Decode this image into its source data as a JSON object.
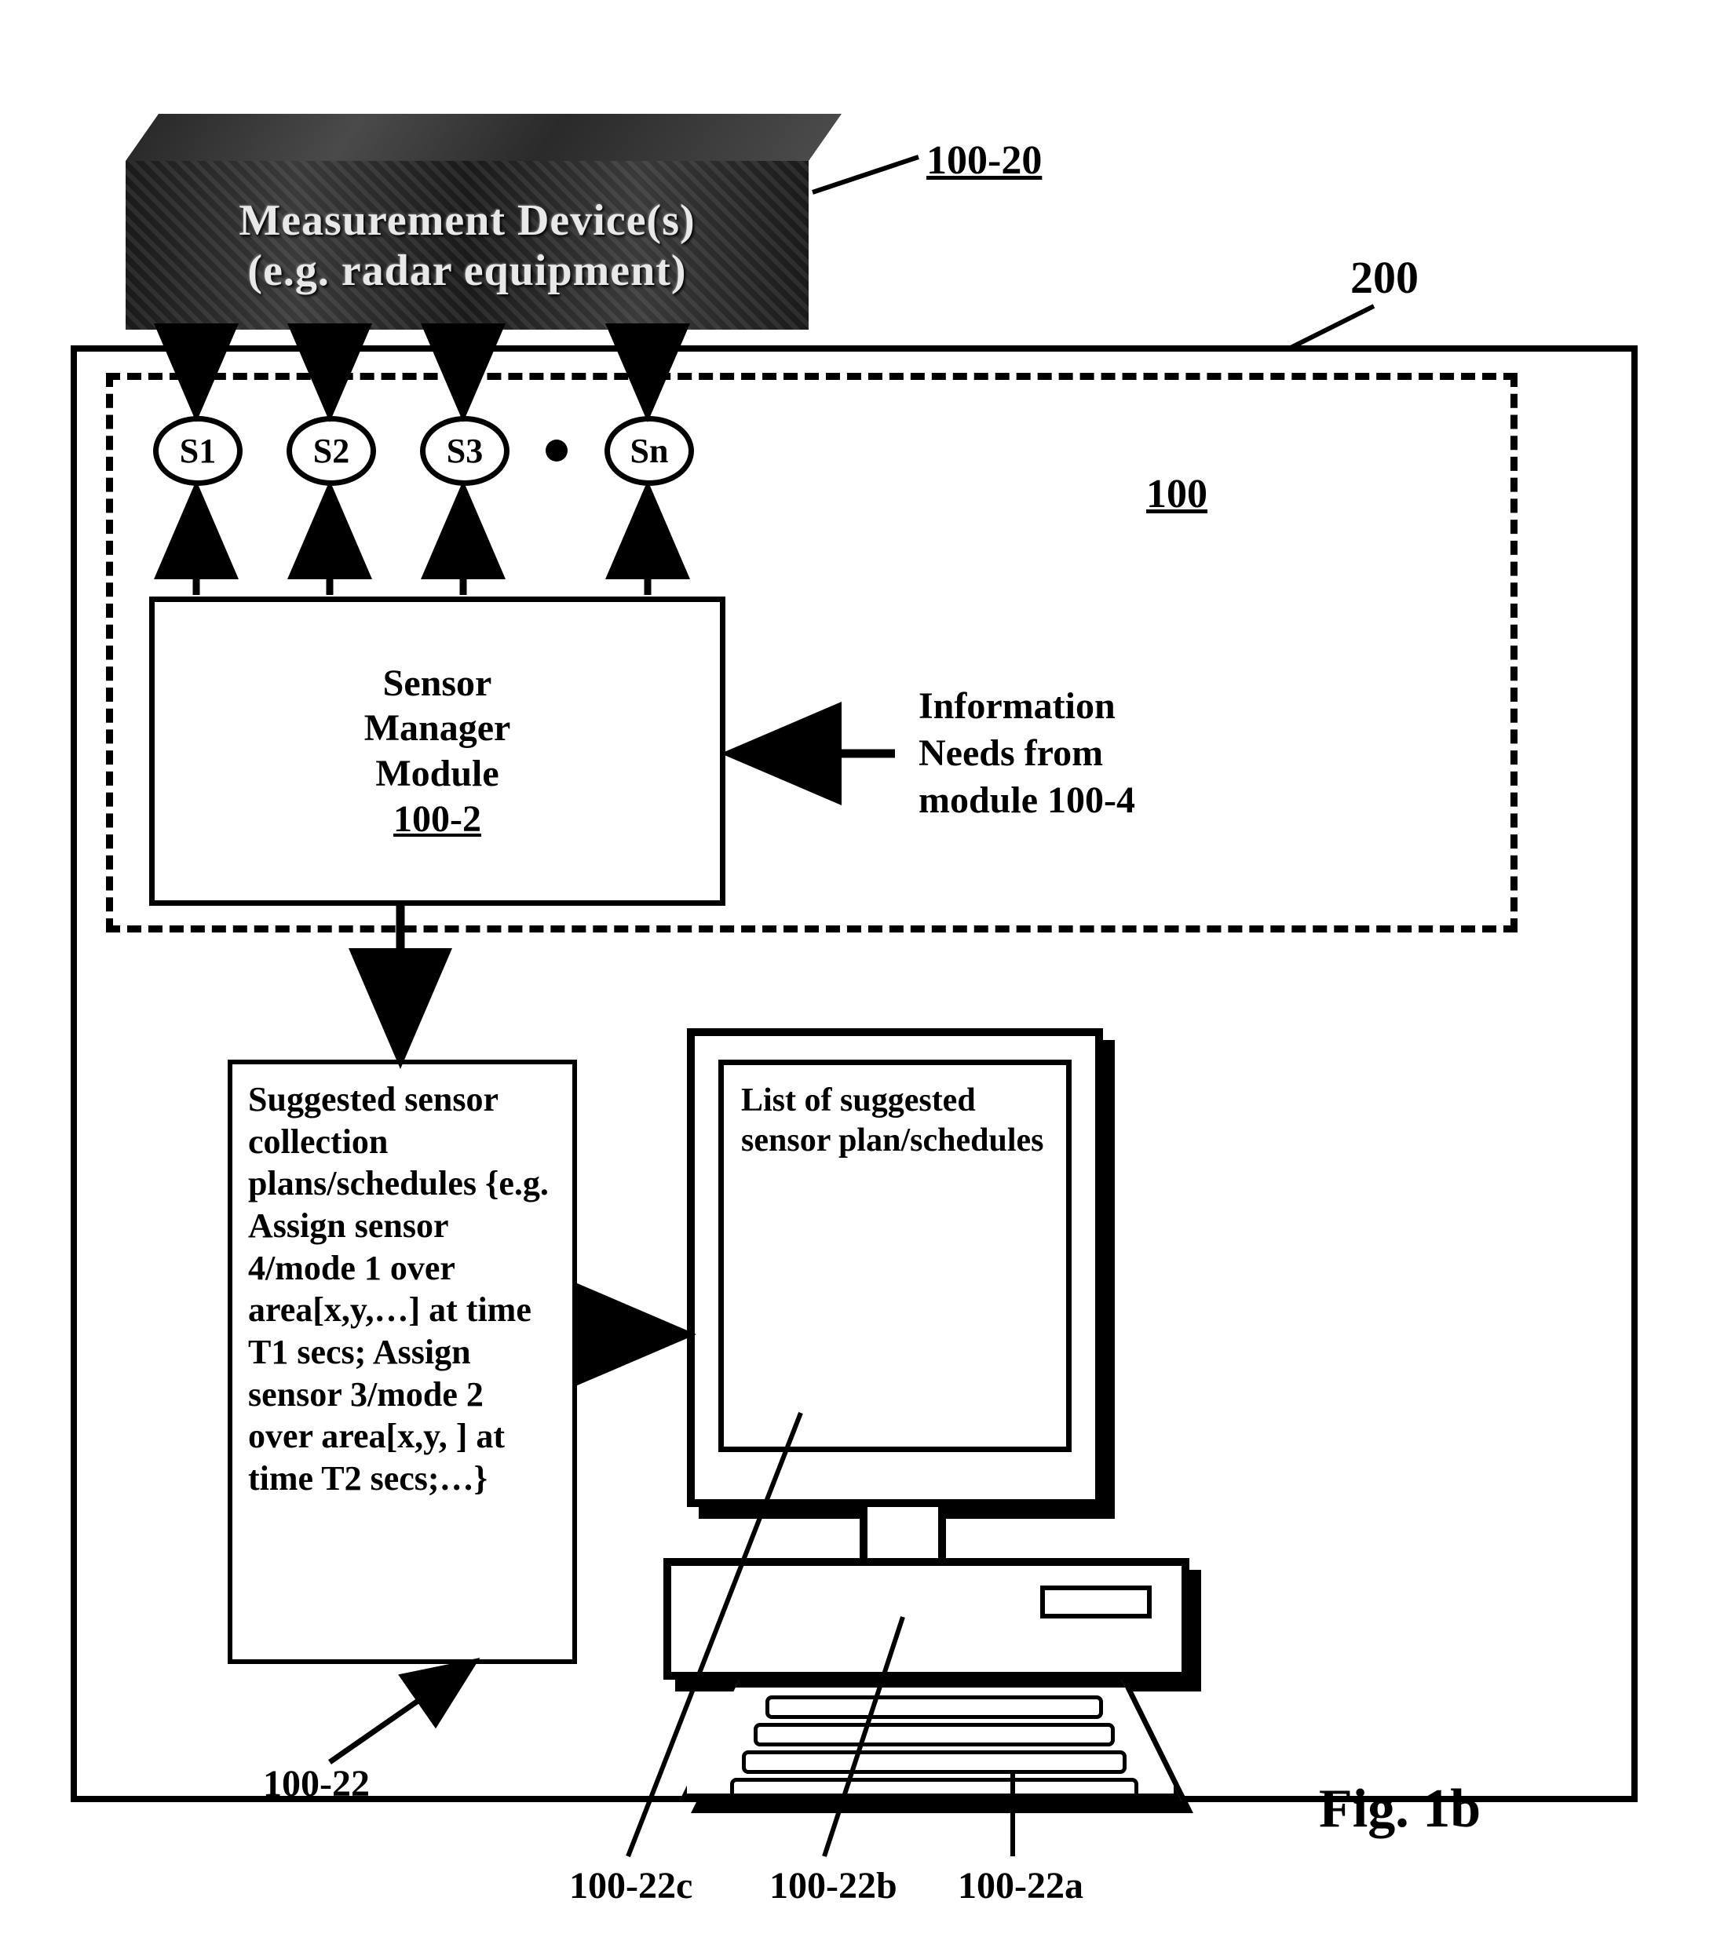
{
  "device": {
    "line1": "Measurement Device(s)",
    "line2": "(e.g. radar equipment)"
  },
  "sensors": {
    "s1": "S1",
    "s2": "S2",
    "s3": "S3",
    "sn": "Sn"
  },
  "smm": {
    "line1": "Sensor",
    "line2": "Manager",
    "line3": "Module",
    "ref": "100-2"
  },
  "info": {
    "line1": "Information",
    "line2": "Needs from",
    "line3": "module 100-4"
  },
  "suggest": {
    "text": "Suggested sensor collection plans/schedules {e.g.\nAssign sensor 4/mode 1 over area[x,y,…] at time T1 secs; Assign sensor 3/mode 2 over area[x,y,  ] at time T2 secs;…}"
  },
  "monitor": {
    "text": "List of suggested sensor plan/schedules"
  },
  "refs": {
    "r100_20": "100-20",
    "r200": "200",
    "r100": "100",
    "r100_22": "100-22",
    "r100_22c": "100-22c",
    "r100_22b": "100-22b",
    "r100_22a": "100-22a"
  },
  "figure": "Fig. 1b"
}
